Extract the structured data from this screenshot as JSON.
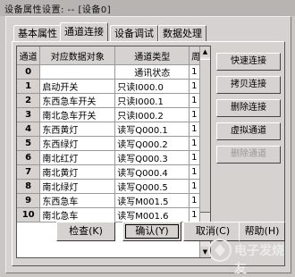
{
  "window": {
    "title": "设备属性设置:    -- [设备0]"
  },
  "tabs": [
    {
      "label": "基本属性"
    },
    {
      "label": "通道连接"
    },
    {
      "label": "设备调试"
    },
    {
      "label": "数据处理"
    }
  ],
  "table": {
    "columns": [
      "通道",
      "对应数据对象",
      "通道类型",
      "周"
    ],
    "rows": [
      {
        "ch": "0",
        "obj": "",
        "type": "通讯状态",
        "cycle": "1"
      },
      {
        "ch": "1",
        "obj": "启动开关",
        "type": "只读I000.0",
        "cycle": "1"
      },
      {
        "ch": "2",
        "obj": "东西急车开关",
        "type": "只读I000.1",
        "cycle": "1"
      },
      {
        "ch": "3",
        "obj": "南北急车开关",
        "type": "只读I000.2",
        "cycle": "1"
      },
      {
        "ch": "4",
        "obj": "东西黄灯",
        "type": "读写Q000.1",
        "cycle": "1"
      },
      {
        "ch": "5",
        "obj": "东西绿灯",
        "type": "读写Q000.2",
        "cycle": "1"
      },
      {
        "ch": "6",
        "obj": "南北红灯",
        "type": "读写Q000.3",
        "cycle": "1"
      },
      {
        "ch": "7",
        "obj": "南北黄灯",
        "type": "读写Q000.4",
        "cycle": "1"
      },
      {
        "ch": "8",
        "obj": "南北绿灯",
        "type": "读写Q000.5",
        "cycle": "1"
      },
      {
        "ch": "9",
        "obj": "东西急车",
        "type": "读写M001.5",
        "cycle": "1"
      },
      {
        "ch": "10",
        "obj": "南北急车",
        "type": "读写M001.6",
        "cycle": "1"
      }
    ]
  },
  "side_buttons": [
    {
      "label": "快速连接"
    },
    {
      "label": "拷贝连接"
    },
    {
      "label": "删除连接"
    },
    {
      "label": "虚拟通道"
    },
    {
      "label": "删除通道"
    }
  ],
  "bottom_buttons": [
    {
      "label": "检查(K)"
    },
    {
      "label": "确认(Y)"
    },
    {
      "label": "取消(C)"
    },
    {
      "label": "帮助(H)"
    }
  ],
  "watermark": "电子发烧友"
}
